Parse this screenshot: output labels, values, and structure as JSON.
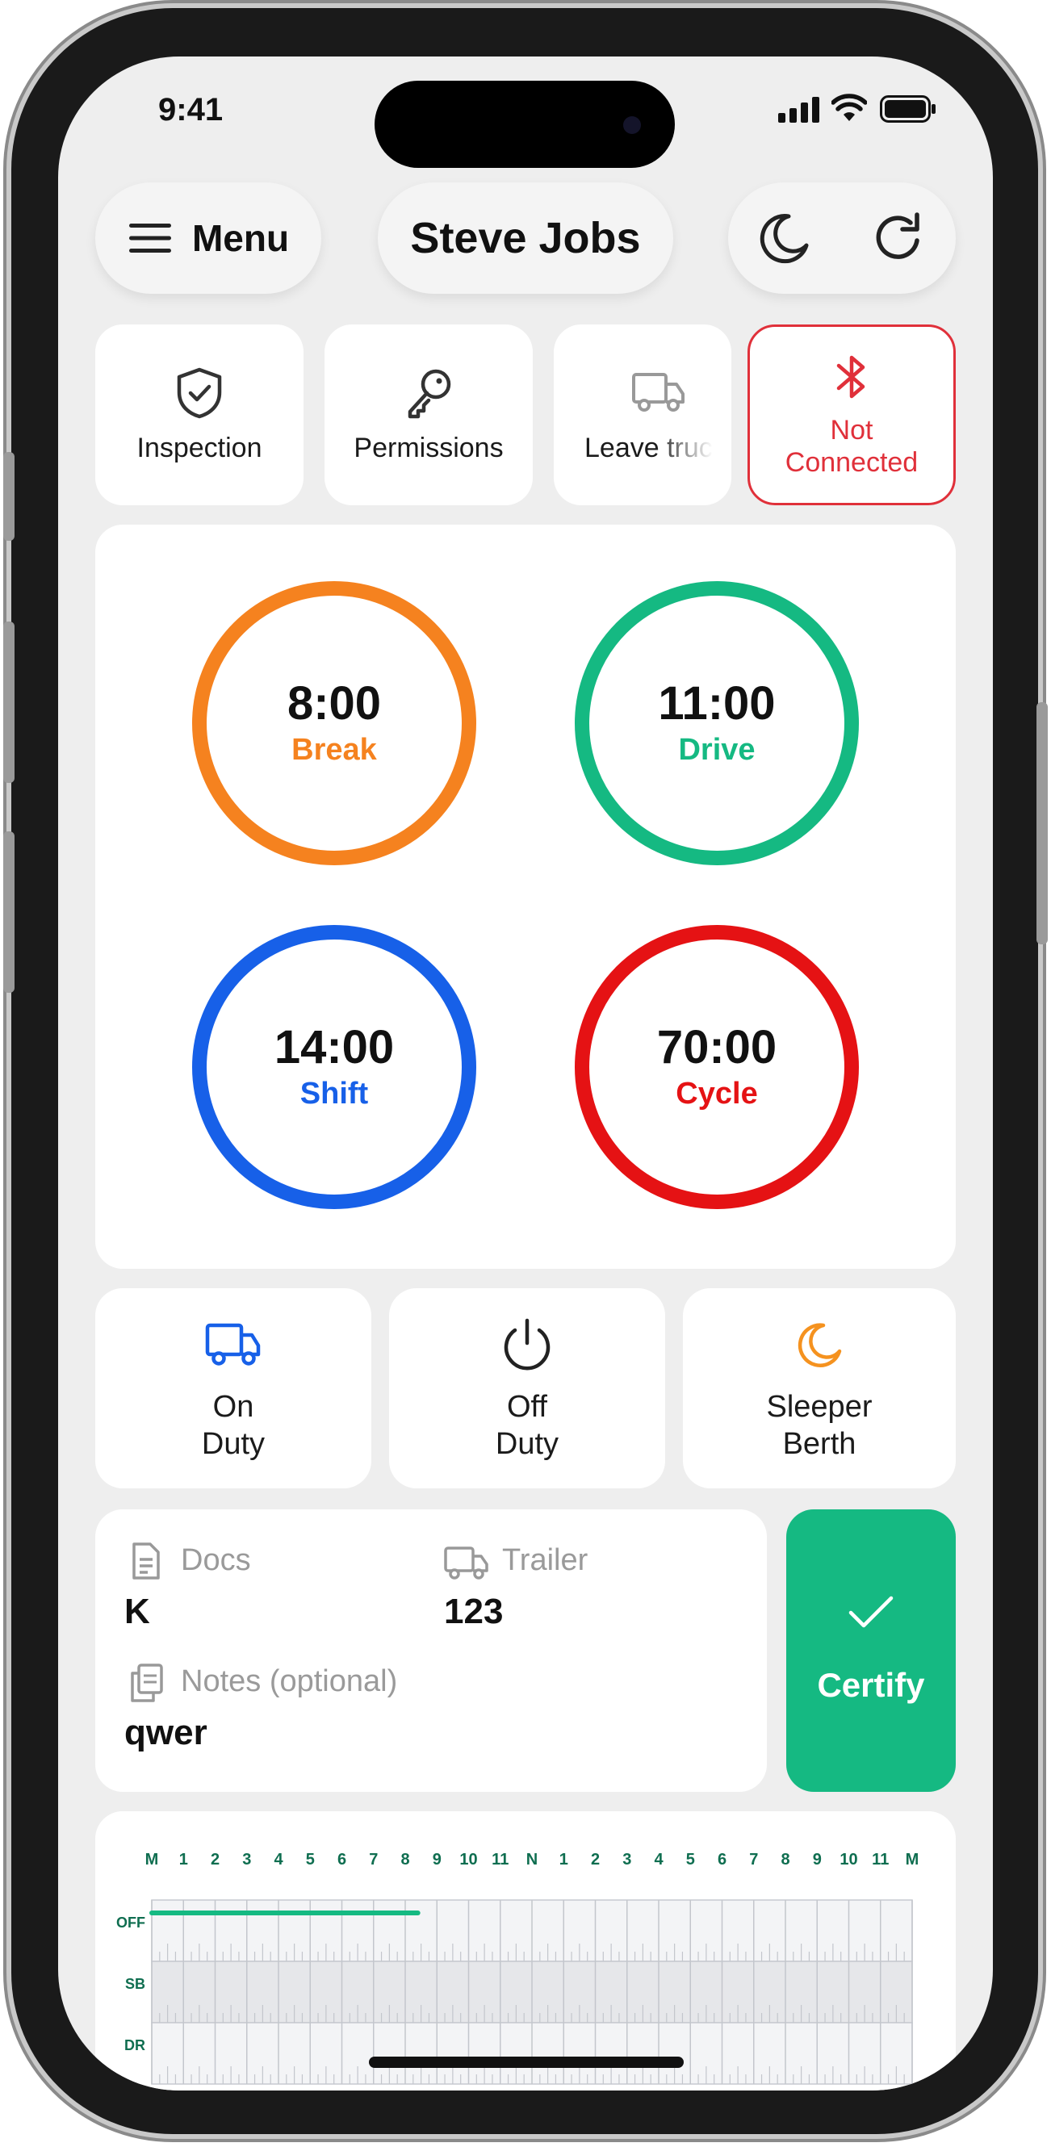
{
  "status_bar": {
    "time": "9:41"
  },
  "header": {
    "menu_label": "Menu",
    "driver_name": "Steve Jobs",
    "icons": [
      "hamburger-icon",
      "moon-icon",
      "refresh-icon"
    ]
  },
  "quick_actions": [
    {
      "label": "Inspection",
      "icon": "shield-check-icon"
    },
    {
      "label": "Permissions",
      "icon": "key-icon"
    },
    {
      "label": "Leave truc",
      "icon": "truck-icon"
    },
    {
      "label_line1": "Not",
      "label_line2": "Connected",
      "icon": "bluetooth-icon",
      "color": "#e0303a"
    }
  ],
  "timers": [
    {
      "time": "8:00",
      "label": "Break",
      "color": "#f5821f"
    },
    {
      "time": "11:00",
      "label": "Drive",
      "color": "#15b982"
    },
    {
      "time": "14:00",
      "label": "Shift",
      "color": "#1760e8"
    },
    {
      "time": "70:00",
      "label": "Cycle",
      "color": "#e51214"
    }
  ],
  "duty_status": [
    {
      "line1": "On",
      "line2": "Duty",
      "icon": "truck-icon",
      "icon_color": "#1760e8"
    },
    {
      "line1": "Off",
      "line2": "Duty",
      "icon": "power-icon",
      "icon_color": "#222222"
    },
    {
      "line1": "Sleeper",
      "line2": "Berth",
      "icon": "moon-icon",
      "icon_color": "#f5921f"
    }
  ],
  "log_info": {
    "docs_label": "Docs",
    "docs_value": "K",
    "trailer_label": "Trailer",
    "trailer_value": "123",
    "notes_label": "Notes (optional)",
    "notes_value": "qwer"
  },
  "certify": {
    "label": "Certify",
    "color": "#15b982"
  },
  "log_graph": {
    "hour_labels": [
      "M",
      "1",
      "2",
      "3",
      "4",
      "5",
      "6",
      "7",
      "8",
      "9",
      "10",
      "11",
      "N",
      "1",
      "2",
      "3",
      "4",
      "5",
      "6",
      "7",
      "8",
      "9",
      "10",
      "11",
      "M"
    ],
    "rows": [
      "OFF",
      "SB",
      "DR"
    ],
    "off_duty_segment_hours": [
      0,
      8.4
    ],
    "segment_color": "#15b982"
  }
}
